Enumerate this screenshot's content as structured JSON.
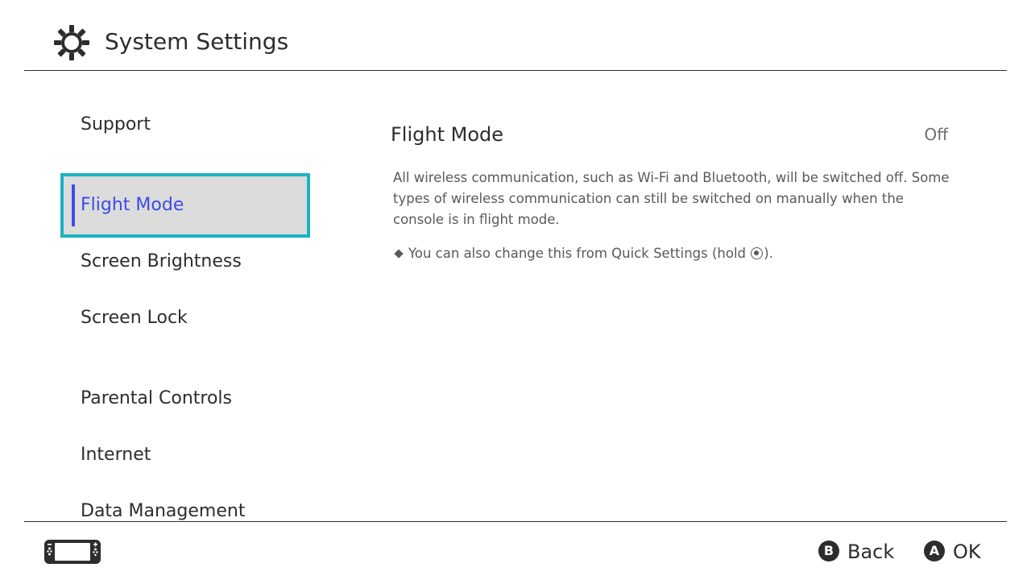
{
  "header": {
    "title": "System Settings",
    "icon": "gear-icon"
  },
  "sidebar": {
    "items": [
      {
        "label": "Support",
        "selected": false
      },
      {
        "label": "Flight Mode",
        "selected": true
      },
      {
        "label": "Screen Brightness",
        "selected": false
      },
      {
        "label": "Screen Lock",
        "selected": false
      },
      {
        "label": "Parental Controls",
        "selected": false
      },
      {
        "label": "Internet",
        "selected": false
      },
      {
        "label": "Data Management",
        "selected": false
      }
    ]
  },
  "main": {
    "setting_title": "Flight Mode",
    "setting_value": "Off",
    "description": "All wireless communication, such as Wi-Fi and Bluetooth, will be switched off. Some types of wireless communication can still be switched on manually when the console is in flight mode.",
    "note_prefix": "You can also change this from Quick Settings (hold",
    "note_suffix": ")."
  },
  "footer": {
    "console_icon": "handheld-console-icon",
    "back_button_glyph": "B",
    "back_label": "Back",
    "ok_button_glyph": "A",
    "ok_label": "OK"
  },
  "colors": {
    "selection_border": "#1bb3c4",
    "selection_accent": "#3c4be6",
    "selection_background": "#dcdcdc",
    "text": "#2d2d2d"
  }
}
